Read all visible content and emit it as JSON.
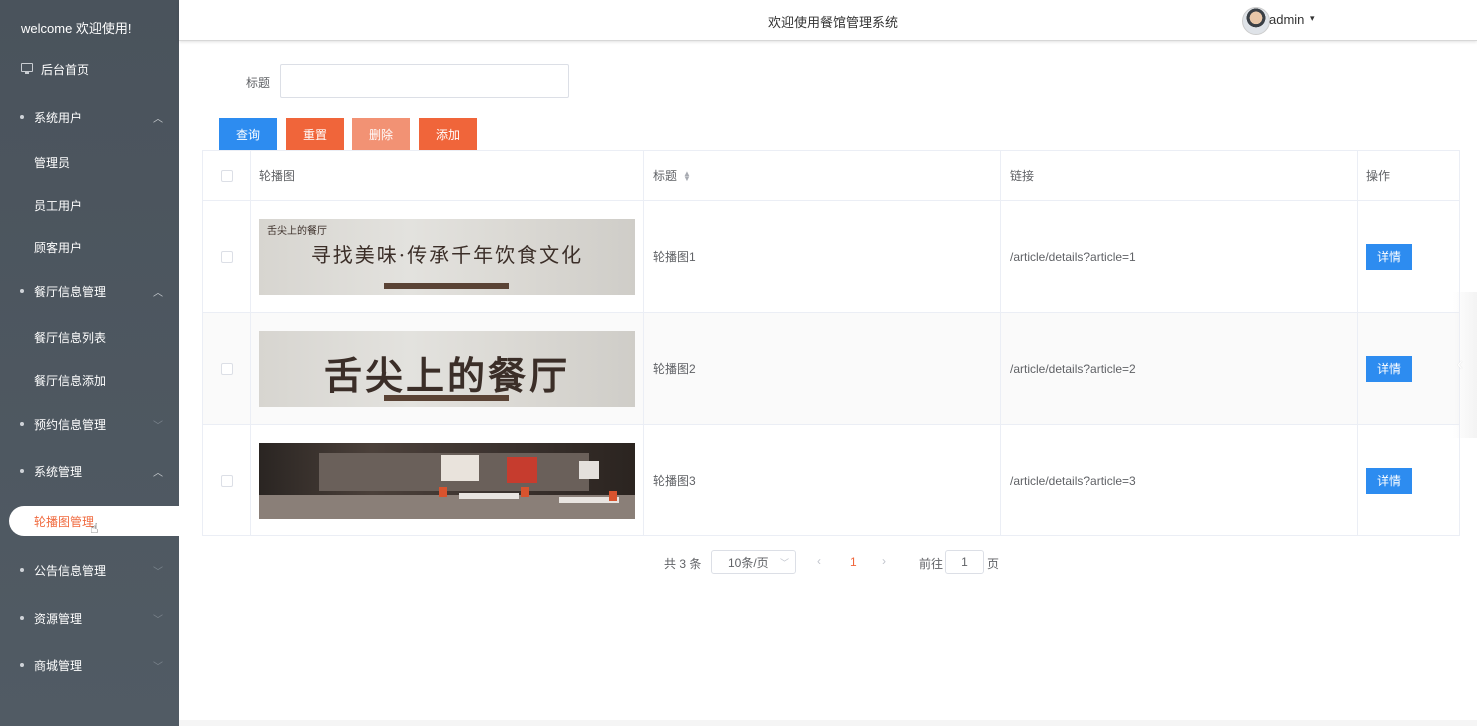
{
  "sidebar": {
    "welcome": "welcome 欢迎使用!",
    "home": "后台首页",
    "items": [
      {
        "label": "系统用户",
        "chevron": "^"
      },
      {
        "label": "管理员"
      },
      {
        "label": "员工用户"
      },
      {
        "label": "顾客用户"
      },
      {
        "label": "餐厅信息管理",
        "chevron": "^"
      },
      {
        "label": "餐厅信息列表"
      },
      {
        "label": "餐厅信息添加"
      },
      {
        "label": "预约信息管理",
        "chevron": "v"
      },
      {
        "label": "系统管理",
        "chevron": "^"
      },
      {
        "label": "轮播图管理"
      },
      {
        "label": "公告信息管理",
        "chevron": "v"
      },
      {
        "label": "资源管理",
        "chevron": "v"
      },
      {
        "label": "商城管理",
        "chevron": "v"
      }
    ]
  },
  "header": {
    "title": "欢迎使用餐馆管理系统",
    "user": "admin"
  },
  "search": {
    "label": "标题",
    "value": "",
    "placeholder": ""
  },
  "buttons": {
    "query": "查询",
    "reset": "重置",
    "delete": "删除",
    "add": "添加"
  },
  "table": {
    "columns": [
      "轮播图",
      "标题",
      "链接",
      "操作"
    ],
    "rows": [
      {
        "banner_main": "寻找美味·传承千年饮食文化",
        "banner_logo": "舌尖上的餐厅",
        "title": "轮播图1",
        "link": "/article/details?article=1",
        "action": "详情"
      },
      {
        "banner_main": "舌尖上的餐厅",
        "banner_logo": "",
        "title": "轮播图2",
        "link": "/article/details?article=2",
        "action": "详情"
      },
      {
        "banner_main": "",
        "banner_logo": "",
        "title": "轮播图3",
        "link": "/article/details?article=3",
        "action": "详情"
      }
    ]
  },
  "pagination": {
    "total": "共 3 条",
    "page_size": "10条/页",
    "current_page": "1",
    "goto_label": "前往",
    "goto_value": "1",
    "goto_unit": "页"
  }
}
